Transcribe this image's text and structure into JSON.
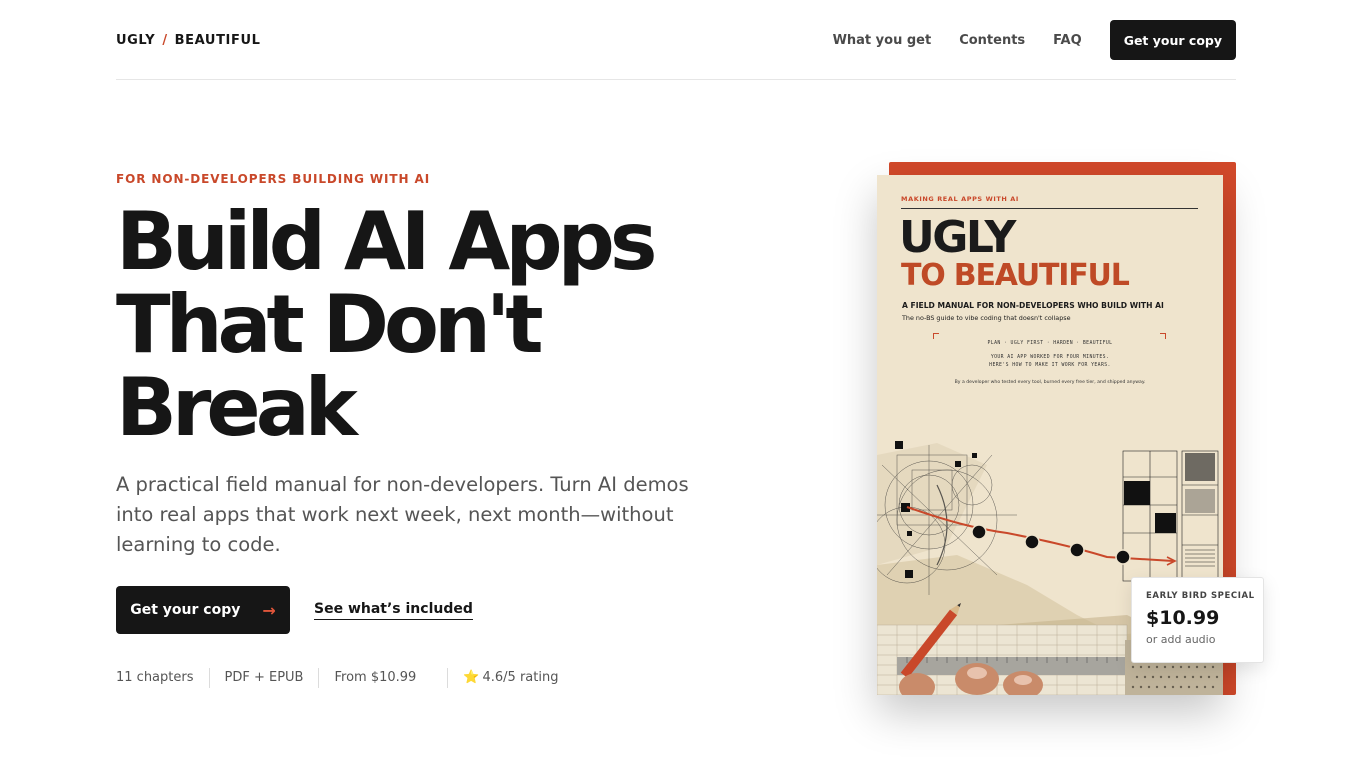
{
  "nav": {
    "logo_left": "UGLY",
    "logo_sep": "/",
    "logo_right": "BEAUTIFUL",
    "links": [
      "What you get",
      "Contents",
      "FAQ"
    ],
    "cta": "Get your copy"
  },
  "hero": {
    "eyebrow": "FOR NON-DEVELOPERS BUILDING WITH AI",
    "headline_lines": [
      "Build AI Apps",
      "That Don't",
      "Break"
    ],
    "subtitle": "A practical field manual for non-developers. Turn AI demos into real apps that work next week, next month—without learning to code.",
    "primary_cta": "Get your copy",
    "primary_cta_arrow": "→",
    "secondary_cta": "See what’s included",
    "meta": [
      "11 chapters",
      "PDF + EPUB",
      "From $10.99"
    ],
    "rating_icon": "star-icon",
    "rating_glyph": "⭐",
    "rating": "4.6/5 rating"
  },
  "book": {
    "kicker": "MAKING REAL APPS WITH AI",
    "title_line1": "UGLY",
    "title_line2": "TO BEAUTIFUL",
    "subtitle": "A FIELD MANUAL FOR NON-DEVELOPERS WHO BUILD WITH AI",
    "tagline": "The no-BS guide to vibe coding that doesn't collapse",
    "steps": "PLAN · UGLY FIRST · HARDEN · BEAUTIFUL",
    "hook1": "YOUR AI APP WORKED FOR FOUR MINUTES.",
    "hook2": "HERE'S HOW TO MAKE IT WORK FOR YEARS.",
    "author": "By a developer who tested every tool, burned every free tier, and shipped anyway.",
    "accent_color": "#c9482a",
    "paper_color": "#efe4cd"
  },
  "price_card": {
    "label": "EARLY BIRD SPECIAL",
    "price": "$10.99",
    "note": "or add audio"
  }
}
